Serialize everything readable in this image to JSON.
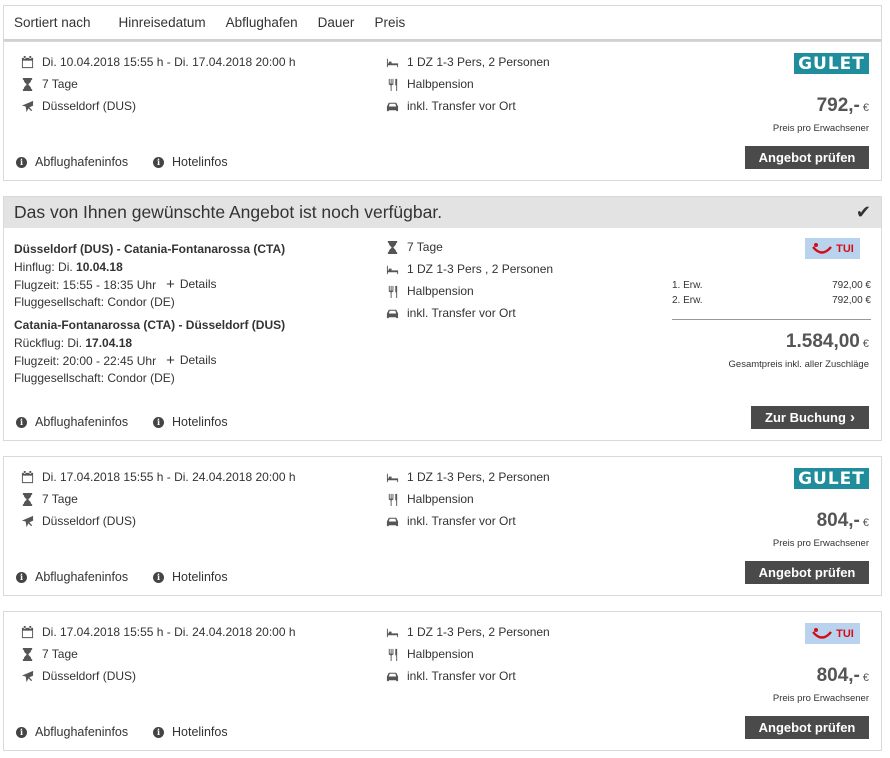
{
  "sort": {
    "label": "Sortiert nach",
    "options": [
      "Hinreisedatum",
      "Abflughafen",
      "Dauer",
      "Preis"
    ]
  },
  "links": {
    "airport": "Abflughafeninfos",
    "hotel": "Hotelinfos"
  },
  "offers": [
    {
      "dates": "Di. 10.04.2018 15:55 h - Di. 17.04.2018 20:00 h",
      "duration": "7 Tage",
      "airport": "Düsseldorf (DUS)",
      "room": "1 DZ 1-3 Pers, 2 Personen",
      "board": "Halbpension",
      "transfer": "inkl. Transfer vor Ort",
      "operator": "GULET",
      "price": "792,-",
      "currency": "€",
      "price_note": "Preis pro Erwachsener",
      "button": "Angebot prüfen"
    },
    {
      "dates": "Di. 17.04.2018 15:55 h - Di. 24.04.2018 20:00 h",
      "duration": "7 Tage",
      "airport": "Düsseldorf (DUS)",
      "room": "1 DZ 1-3 Pers, 2 Personen",
      "board": "Halbpension",
      "transfer": "inkl. Transfer vor Ort",
      "operator": "GULET",
      "price": "804,-",
      "currency": "€",
      "price_note": "Preis pro Erwachsener",
      "button": "Angebot prüfen"
    },
    {
      "dates": "Di. 17.04.2018 15:55 h - Di. 24.04.2018 20:00 h",
      "duration": "7 Tage",
      "airport": "Düsseldorf (DUS)",
      "room": "1 DZ 1-3 Pers, 2 Personen",
      "board": "Halbpension",
      "transfer": "inkl. Transfer vor Ort",
      "operator": "TUI",
      "price": "804,-",
      "currency": "€",
      "price_note": "Preis pro Erwachsener",
      "button": "Angebot prüfen"
    }
  ],
  "available": {
    "headline": "Das von Ihnen gewünschte Angebot ist noch verfügbar.",
    "outbound": {
      "route": "Düsseldorf (DUS) - Catania-Fontanarossa (CTA)",
      "date_label": "Hinflug: Di. ",
      "date": "10.04.18",
      "time": "Flugzeit: 15:55 - 18:35 Uhr",
      "airline": "Fluggesellschaft: Condor (DE)"
    },
    "inbound": {
      "route": "Catania-Fontanarossa (CTA) - Düsseldorf (DUS)",
      "date_label": "Rückflug: Di. ",
      "date": "17.04.18",
      "time": "Flugzeit: 20:00 - 22:45 Uhr",
      "airline": "Fluggesellschaft: Condor (DE)"
    },
    "details_label": "Details",
    "duration": "7 Tage",
    "room": "1 DZ 1-3 Pers , 2 Personen",
    "board": "Halbpension",
    "transfer": "inkl. Transfer vor Ort",
    "operator": "TUI",
    "pax": [
      {
        "label": "1. Erw.",
        "price": "792,00 €"
      },
      {
        "label": "2. Erw.",
        "price": "792,00 €"
      }
    ],
    "total": "1.584,00",
    "currency": "€",
    "total_note": "Gesamtpreis inkl. aller Zuschläge",
    "button": "Zur Buchung"
  }
}
